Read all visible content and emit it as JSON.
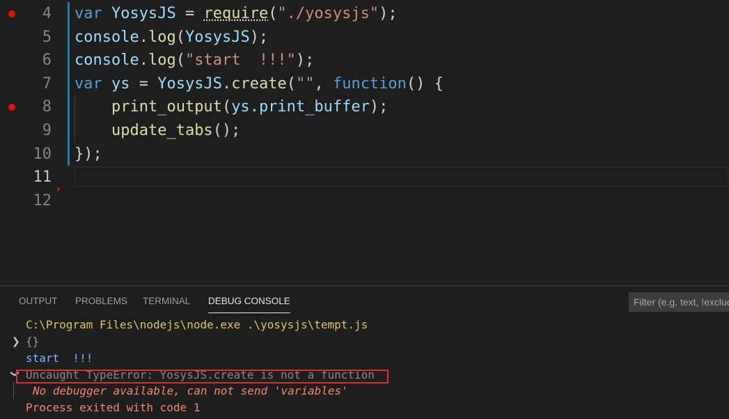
{
  "editor": {
    "lines": [
      {
        "number": "4",
        "breakpoint": true,
        "tokens": [
          {
            "t": "var",
            "c": "kw"
          },
          {
            "t": " ",
            "c": ""
          },
          {
            "t": "YosysJS",
            "c": "var"
          },
          {
            "t": " = ",
            "c": ""
          },
          {
            "t": "require",
            "c": "fn squig"
          },
          {
            "t": "(",
            "c": ""
          },
          {
            "t": "\"./yosysjs\"",
            "c": "str"
          },
          {
            "t": ");",
            "c": ""
          }
        ]
      },
      {
        "number": "5",
        "breakpoint": false,
        "tokens": [
          {
            "t": "console",
            "c": "var"
          },
          {
            "t": ".",
            "c": ""
          },
          {
            "t": "log",
            "c": "fn"
          },
          {
            "t": "(",
            "c": ""
          },
          {
            "t": "YosysJS",
            "c": "var"
          },
          {
            "t": ");",
            "c": ""
          }
        ]
      },
      {
        "number": "6",
        "breakpoint": false,
        "tokens": [
          {
            "t": "console",
            "c": "var"
          },
          {
            "t": ".",
            "c": ""
          },
          {
            "t": "log",
            "c": "fn"
          },
          {
            "t": "(",
            "c": ""
          },
          {
            "t": "\"start  !!!\"",
            "c": "str"
          },
          {
            "t": ");",
            "c": ""
          }
        ]
      },
      {
        "number": "7",
        "breakpoint": false,
        "tokens": [
          {
            "t": "var",
            "c": "kw"
          },
          {
            "t": " ",
            "c": ""
          },
          {
            "t": "ys",
            "c": "var"
          },
          {
            "t": " = ",
            "c": ""
          },
          {
            "t": "YosysJS",
            "c": "var"
          },
          {
            "t": ".",
            "c": ""
          },
          {
            "t": "create",
            "c": "fn"
          },
          {
            "t": "(",
            "c": ""
          },
          {
            "t": "\"\"",
            "c": "str"
          },
          {
            "t": ", ",
            "c": ""
          },
          {
            "t": "function",
            "c": "kw"
          },
          {
            "t": "() {",
            "c": ""
          }
        ]
      },
      {
        "number": "8",
        "breakpoint": true,
        "indent": true,
        "tokens": [
          {
            "t": "    ",
            "c": ""
          },
          {
            "t": "print_output",
            "c": "fn"
          },
          {
            "t": "(",
            "c": ""
          },
          {
            "t": "ys",
            "c": "var"
          },
          {
            "t": ".",
            "c": ""
          },
          {
            "t": "print_buffer",
            "c": "var"
          },
          {
            "t": ");",
            "c": ""
          }
        ]
      },
      {
        "number": "9",
        "breakpoint": false,
        "indent": true,
        "tokens": [
          {
            "t": "    ",
            "c": ""
          },
          {
            "t": "update_tabs",
            "c": "fn"
          },
          {
            "t": "();",
            "c": ""
          }
        ]
      },
      {
        "number": "10",
        "breakpoint": false,
        "tokens": [
          {
            "t": "});",
            "c": ""
          }
        ]
      },
      {
        "number": "11",
        "breakpoint": false,
        "active": true,
        "tokens": []
      },
      {
        "number": "12",
        "breakpoint": false,
        "tokens": []
      }
    ]
  },
  "panel": {
    "tabs": [
      {
        "label": "OUTPUT",
        "active": false
      },
      {
        "label": "PROBLEMS",
        "active": false
      },
      {
        "label": "TERMINAL",
        "active": false
      },
      {
        "label": "DEBUG CONSOLE",
        "active": true
      }
    ],
    "filter_placeholder": "Filter (e.g. text, !exclude)",
    "console": {
      "command": "C:\\Program Files\\nodejs\\node.exe .\\yosysjs\\tempt.js",
      "object": "{}",
      "start": "start  !!!",
      "error": "Uncaught TypeError: YosysJS.create is not a function",
      "debugger_msg": "No debugger available, can not send 'variables'",
      "exit": "Process exited with code 1"
    },
    "colors": {
      "command": "#dbc569",
      "object": "#9a9a9a",
      "start": "#75beff",
      "error": "#8a8a8a",
      "debugger_msg": "#f48771",
      "exit": "#f48771",
      "highlight_box": "#e0302a"
    }
  }
}
